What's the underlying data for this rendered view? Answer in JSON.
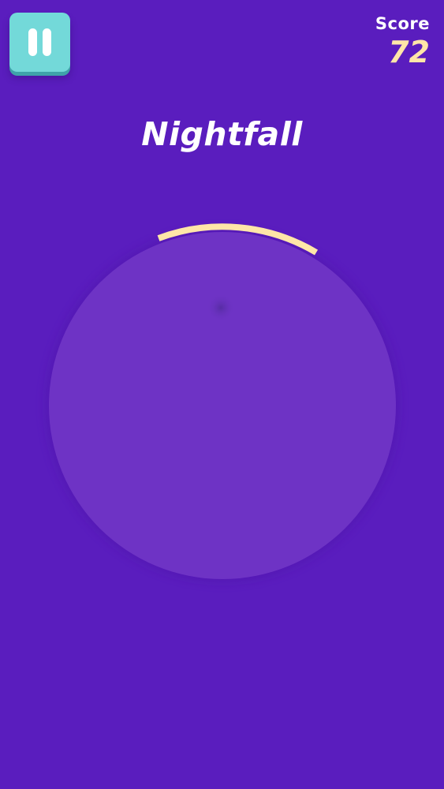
{
  "hud": {
    "pause_icon": "pause-icon",
    "score_label": "Score",
    "score_value": "72"
  },
  "level": {
    "title": "Nightfall"
  },
  "colors": {
    "background": "#5a1dbe",
    "planet": "#6e33c5",
    "arc": "#ffe6a8",
    "pause_button": "#73d9d9",
    "score_value": "#ffe6a8"
  }
}
